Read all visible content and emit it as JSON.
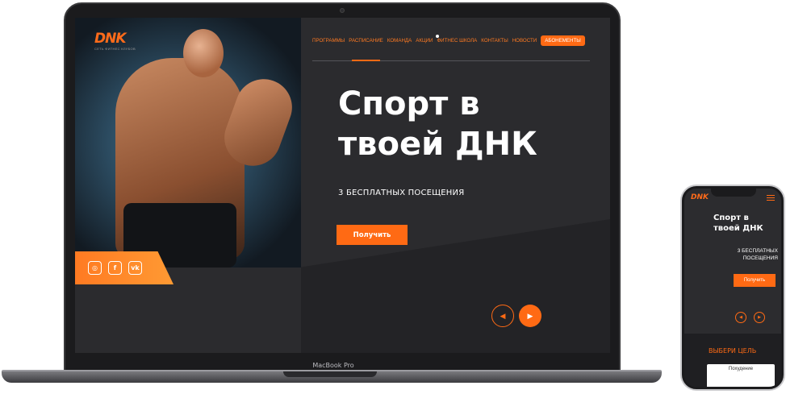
{
  "laptop": {
    "brand_label": "MacBook Pro"
  },
  "site": {
    "logo": {
      "mark": "DNK",
      "tagline": "СЕТЬ ФИТНЕС КЛУБОВ"
    },
    "nav": {
      "items": [
        "ПРОГРАММЫ",
        "РАСПИСАНИЕ",
        "КОМАНДА",
        "АКЦИИ",
        "ФИТНЕС ШКОЛА",
        "КОНТАКТЫ",
        "НОВОСТИ"
      ],
      "cta": "АБОНЕМЕНТЫ",
      "active_index": 1
    },
    "hero": {
      "headline": "Спорт в твоей ДНК",
      "subline": "3 БЕСПЛАТНЫХ ПОСЕЩЕНИЯ",
      "cta": "Получить"
    },
    "social": {
      "icons": [
        "instagram-icon",
        "facebook-icon",
        "vk-icon"
      ],
      "glyphs": [
        "◎",
        "f",
        "vk"
      ]
    },
    "slider": {
      "prev_glyph": "◀",
      "next_glyph": "▶"
    }
  },
  "phone": {
    "logo": "DNK",
    "headline": "Спорт в твоей ДНК",
    "subline": "3 БЕСПЛАТНЫХ ПОСЕЩЕНИЯ",
    "cta": "Получить",
    "section_title": "ВЫБЕРИ ЦЕЛЬ",
    "card_label": "Похудение"
  },
  "colors": {
    "accent": "#ff6a14",
    "screen_bg": "#2b2b2e",
    "text": "#ffffff"
  }
}
